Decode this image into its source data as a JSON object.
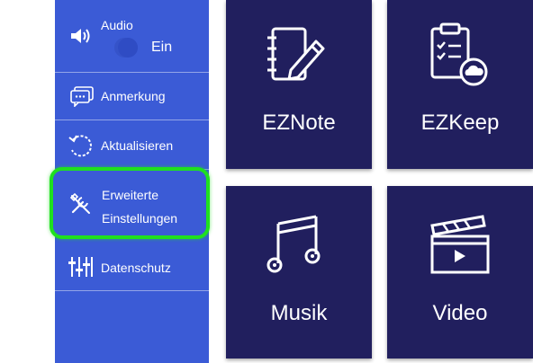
{
  "sidebar": {
    "audio": {
      "label": "Audio",
      "state": "Ein",
      "icon": "speaker-icon"
    },
    "items": [
      {
        "label": "Anmerkung",
        "icon": "comment-icon"
      },
      {
        "label": "Aktualisieren",
        "icon": "refresh-icon"
      },
      {
        "label_line1": "Erweiterte",
        "label_line2": "Einstellungen",
        "icon": "tools-icon",
        "highlighted": true
      },
      {
        "label": "Datenschutz",
        "icon": "sliders-icon"
      }
    ]
  },
  "tiles": [
    {
      "label": "EZNote",
      "icon": "notebook-pencil-icon"
    },
    {
      "label": "EZKeep",
      "icon": "clipboard-cloud-icon"
    },
    {
      "label": "Musik",
      "icon": "music-note-icon"
    },
    {
      "label": "Video",
      "icon": "clapperboard-icon"
    }
  ],
  "colors": {
    "sidebar_bg": "#3b5bd6",
    "tile_bg": "#211f5e",
    "highlight": "#1fe01f"
  }
}
